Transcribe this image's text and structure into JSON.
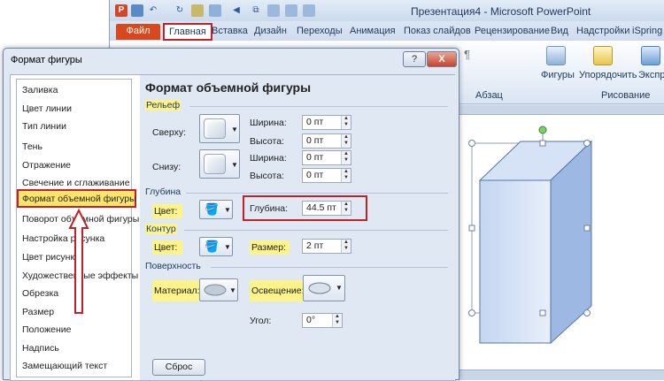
{
  "app": {
    "window_title": "Презентация4 - Microsoft PowerPoint",
    "logo": "P",
    "tabs": [
      "Файл",
      "Главная",
      "Вставка",
      "Дизайн",
      "Переходы",
      "Анимация",
      "Показ слайдов",
      "Рецензирование",
      "Вид",
      "Надстройки",
      "iSpring"
    ],
    "ribbon": {
      "group_paragraph": "Абзац",
      "figures": "Фигуры",
      "arrange": "Упорядочить",
      "express": "Экспресс",
      "group_drawing": "Рисование",
      "format_chars": "¶"
    }
  },
  "dialog": {
    "title": "Формат фигуры",
    "help_label": "?",
    "close_label": "X",
    "nav_items": [
      "Заливка",
      "Цвет линии",
      "Тип линии",
      "Тень",
      "Отражение",
      "Свечение и сглаживание",
      "Формат объемной фигуры",
      "Поворот объемной фигуры",
      "Настройка рисунка",
      "Цвет рисунка",
      "Художественные эффекты",
      "Обрезка",
      "Размер",
      "Положение",
      "Надпись",
      "Замещающий текст"
    ],
    "panel": {
      "title": "Формат объемной фигуры",
      "relief": {
        "section": "Рельеф",
        "top_label": "Сверху:",
        "bottom_label": "Снизу:",
        "top_width_label": "Ширина:",
        "top_width": "0 пт",
        "top_height_label": "Высота:",
        "top_height": "0 пт",
        "bottom_width_label": "Ширина:",
        "bottom_width": "0 пт",
        "bottom_height_label": "Высота:",
        "bottom_height": "0 пт"
      },
      "depth": {
        "section": "Глубина",
        "color_label": "Цвет:",
        "depth_label": "Глубина:",
        "depth_value": "44.5 пт"
      },
      "contour": {
        "section": "Контур",
        "color_label": "Цвет:",
        "size_label": "Размер:",
        "size_value": "2 пт"
      },
      "surface": {
        "section": "Поверхность",
        "material_label": "Материал:",
        "lighting_label": "Освещение:",
        "angle_label": "Угол:",
        "angle_value": "0°"
      },
      "reset_label": "Сброс"
    }
  },
  "colors": {
    "highlight": "#fcf48a",
    "selection": "#fde56a",
    "callout": "#c32127",
    "file_tab": "#d9481c",
    "shape_fill": "#b8cdee"
  },
  "icons": [
    "undo-icon",
    "redo-icon",
    "paint-bucket-icon",
    "pen-icon",
    "material-icon",
    "lighting-icon",
    "help-icon",
    "close-icon",
    "up-arrow-icon"
  ]
}
